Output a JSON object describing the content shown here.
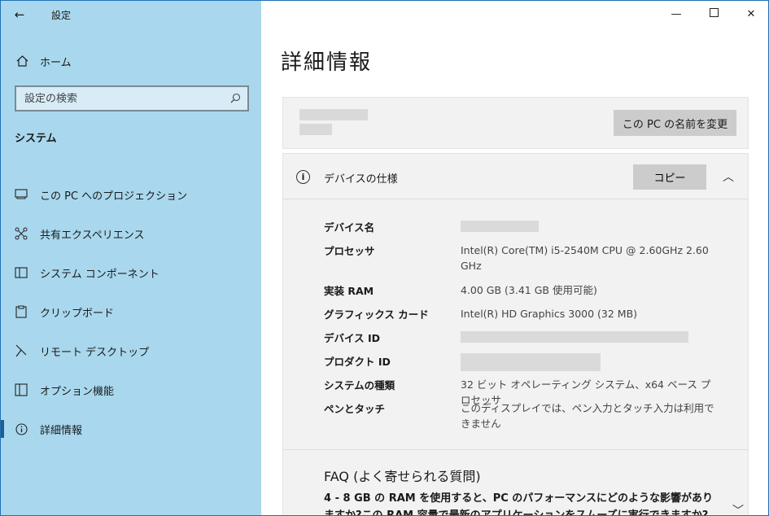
{
  "window": {
    "title": "設定"
  },
  "sidebar": {
    "home_label": "ホーム",
    "search_placeholder": "設定の検索",
    "section": "システム",
    "items": [
      {
        "label": "この PC へのプロジェクション",
        "icon": "projection-icon"
      },
      {
        "label": "共有エクスペリエンス",
        "icon": "shared-experience-icon"
      },
      {
        "label": "システム コンポーネント",
        "icon": "system-component-icon"
      },
      {
        "label": "クリップボード",
        "icon": "clipboard-icon"
      },
      {
        "label": "リモート デスクトップ",
        "icon": "remote-desktop-icon"
      },
      {
        "label": "オプション機能",
        "icon": "optional-features-icon"
      },
      {
        "label": "詳細情報",
        "icon": "info-icon",
        "active": true
      }
    ]
  },
  "main": {
    "title": "詳細情報",
    "rename_button": "この PC の名前を変更",
    "spec": {
      "title": "デバイスの仕様",
      "copy_button": "コピー",
      "rows": [
        {
          "key": "デバイス名",
          "value": ""
        },
        {
          "key": "プロセッサ",
          "value": "Intel(R)   Core(TM)   i5-2540M   CPU   @   2.60GHz 2.60 GHz"
        },
        {
          "key": "実装 RAM",
          "value": "4.00 GB (3.41 GB 使用可能)"
        },
        {
          "key": "グラフィックス カード",
          "value": "Intel(R) HD Graphics 3000 (32 MB)"
        },
        {
          "key": "デバイス ID",
          "value": ""
        },
        {
          "key": "プロダクト ID",
          "value": ""
        },
        {
          "key": "システムの種類",
          "value": "32 ビット オペレーティング システム、x64 ベース プロセッサ"
        },
        {
          "key": "ペンとタッチ",
          "value": "このディスプレイでは、ペン入力とタッチ入力は利用できません"
        }
      ]
    },
    "faq": {
      "title": "FAQ (よく寄せられる質問)",
      "question": "4 - 8 GB の RAM を使用すると、PC のパフォーマンスにどのような影響がありますか?この RAM 容量で最新のアプリケーションをスムーズに実行できますか?"
    }
  }
}
